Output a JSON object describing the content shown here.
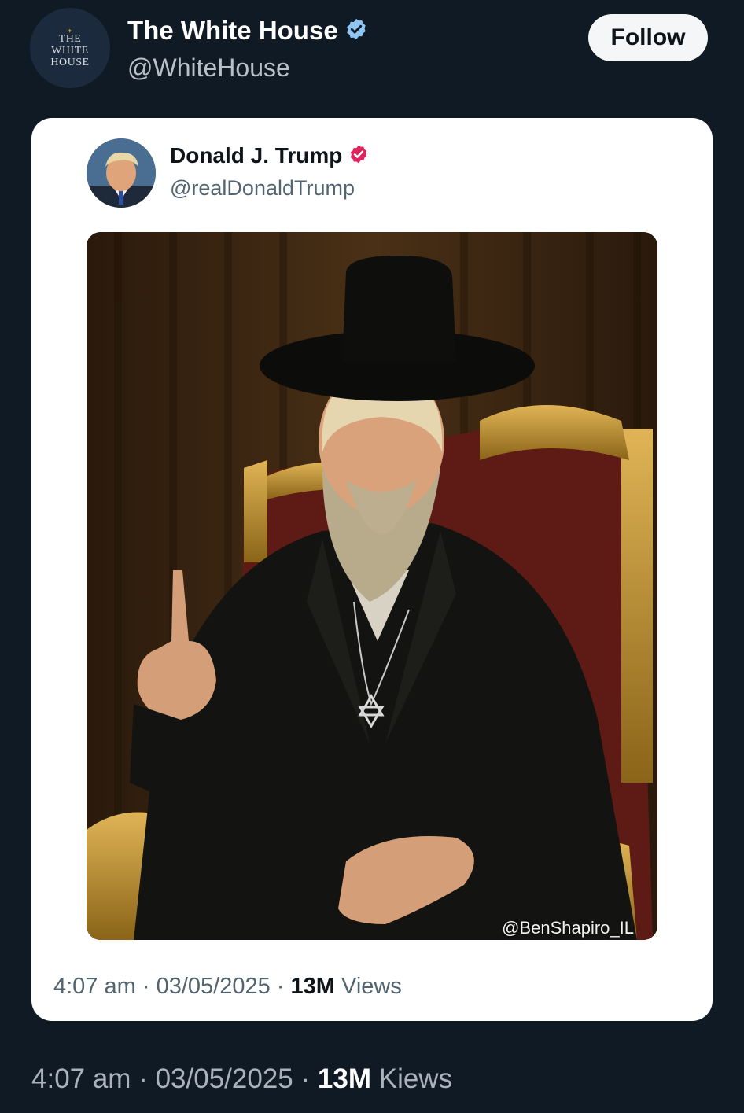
{
  "header": {
    "avatar_lines": [
      "THE",
      "WHITE",
      "HOUSE"
    ],
    "name": "The White House",
    "handle": "@WhiteHouse",
    "follow_label": "Follow",
    "verified_color": "#8ec5f2"
  },
  "quoted": {
    "name": "Donald J. Trump",
    "handle": "@realDonaldTrump",
    "verified_color": "#e0245e",
    "image_watermark": "@BenShapiro_IL",
    "meta": {
      "time": "4:07 am",
      "date": "03/05/2025",
      "views_count": "13M",
      "views_label": "Views"
    }
  },
  "bottom": {
    "meta": {
      "time": "4:07 am",
      "date": "03/05/2025",
      "views_count": "13M",
      "views_label": "Kiews"
    }
  },
  "colors": {
    "background": "#0f1a24",
    "card": "#ffffff",
    "follow_bg": "#f4f6f8"
  }
}
